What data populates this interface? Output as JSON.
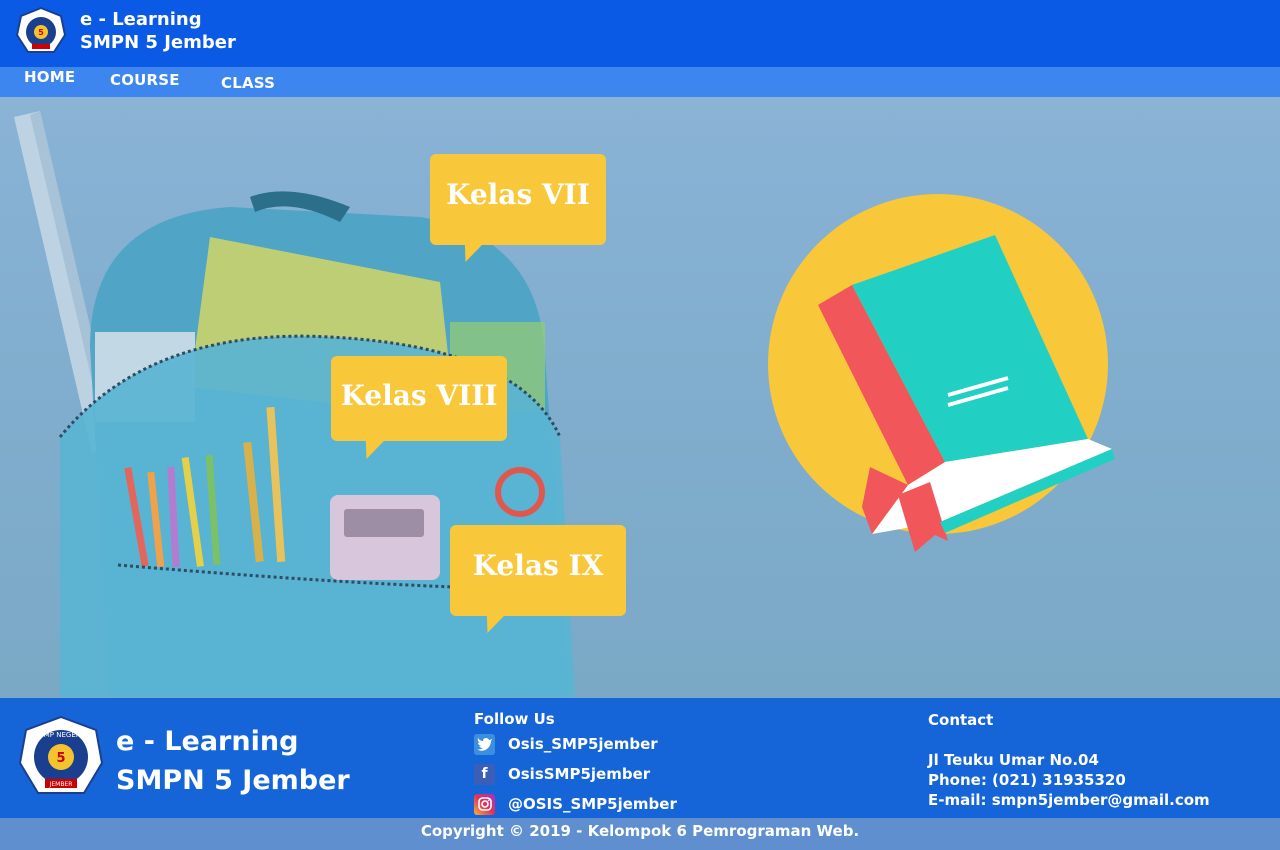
{
  "header": {
    "line1": "e - Learning",
    "line2": "SMPN 5 Jember"
  },
  "nav": {
    "home": "HOME",
    "course": "COURSE",
    "class": "CLASS"
  },
  "hero": {
    "bubbles": [
      "Kelas VII",
      "Kelas VIII",
      "Kelas IX"
    ]
  },
  "footer": {
    "brand_line1": "e - Learning",
    "brand_line2": "SMPN 5 Jember",
    "logo_text_top": "SMP NEGERI",
    "logo_number": "5",
    "logo_text_bottom": "JEMBER",
    "follow_title": "Follow Us",
    "twitter": "Osis_SMP5jember",
    "facebook": "OsisSMP5jember",
    "instagram": "@OSIS_SMP5jember",
    "contact_title": "Contact",
    "address": "Jl Teuku Umar No.04",
    "phone": "Phone: (021) 31935320",
    "email": "E-mail: smpn5jember@gmail.com"
  },
  "copyright": "Copyright © 2019 - Kelompok 6 Pemrograman Web.",
  "colors": {
    "header": "#0a5ae6",
    "nav": "#3d86f0",
    "footer": "#1665d8",
    "copyright_bar": "#5f8fcf",
    "bubble": "#f8c73a"
  },
  "icons": [
    "school-logo-icon",
    "twitter-icon",
    "facebook-icon",
    "instagram-icon",
    "book-icon"
  ]
}
